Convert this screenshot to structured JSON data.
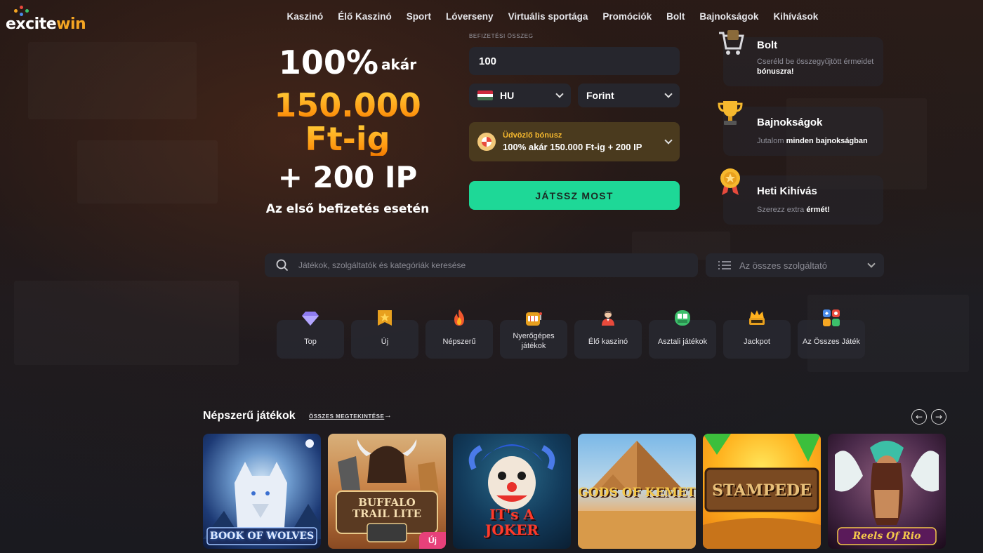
{
  "brand": {
    "logo_part1": "excite",
    "logo_part2": "win"
  },
  "nav": {
    "items": [
      "Kaszinó",
      "Élő Kaszinó",
      "Sport",
      "Lóverseny",
      "Virtuális sportága",
      "Promóciók",
      "Bolt",
      "Bajnokságok",
      "Kihívások"
    ]
  },
  "promo": {
    "line1": "100%",
    "line1_small": "akár",
    "line2": "150.000",
    "line3": "Ft-ig",
    "line4": "+ 200 IP",
    "line5": "Az első befizetés esetén"
  },
  "deposit": {
    "label": "Befizetési összeg",
    "amount": "100",
    "country": "HU",
    "currency": "Forint",
    "bonus_title": "Üdvözlő bónusz",
    "bonus_value": "100% akár 150.000 Ft-ig + 200 IP",
    "cta": "JÁTSSZ MOST"
  },
  "side_cards": [
    {
      "title": "Bolt",
      "desc_pre": "Cseréld be összegyűjtött érmeidet ",
      "desc_bold": "bónuszra!",
      "icon": "cart-icon"
    },
    {
      "title": "Bajnokságok",
      "desc_pre": "Jutalom ",
      "desc_bold": "minden bajnokságban",
      "icon": "trophy-icon"
    },
    {
      "title": "Heti Kihívás",
      "desc_pre": "Szerezz extra ",
      "desc_bold": "érmét!",
      "icon": "medal-icon"
    }
  ],
  "search": {
    "placeholder": "Játékok, szolgáltatók és kategóriák keresése",
    "provider_label": "Az összes szolgáltató"
  },
  "categories": [
    {
      "label": "Top",
      "icon": "diamond-icon"
    },
    {
      "label": "Új",
      "icon": "new-star-icon"
    },
    {
      "label": "Népszerű",
      "icon": "flame-icon"
    },
    {
      "label": "Nyerőgépes játékok",
      "icon": "slot-machine-icon"
    },
    {
      "label": "Élő kaszinó",
      "icon": "dealer-icon"
    },
    {
      "label": "Asztali játékok",
      "icon": "table-game-icon"
    },
    {
      "label": "Jackpot",
      "icon": "jackpot-icon"
    },
    {
      "label": "Az Összes Játék",
      "icon": "all-games-icon"
    }
  ],
  "popular": {
    "title": "Népszerű játékok",
    "see_all": "Összes megtekintése",
    "games": [
      {
        "name": "BOOK OF WOLVES",
        "badge": ""
      },
      {
        "name": "BUFFALO TRAIL LITE",
        "badge": "Új"
      },
      {
        "name": "IT's A JOKER",
        "badge": ""
      },
      {
        "name": "GODS OF KEMET",
        "badge": ""
      },
      {
        "name": "STAMPEDE",
        "badge": ""
      },
      {
        "name": "Reels Of Rio",
        "badge": ""
      }
    ]
  },
  "colors": {
    "accent_green": "#1ed897",
    "gold": "#ffb21e",
    "new_badge": "#e7417a",
    "panel": "#26262d"
  }
}
